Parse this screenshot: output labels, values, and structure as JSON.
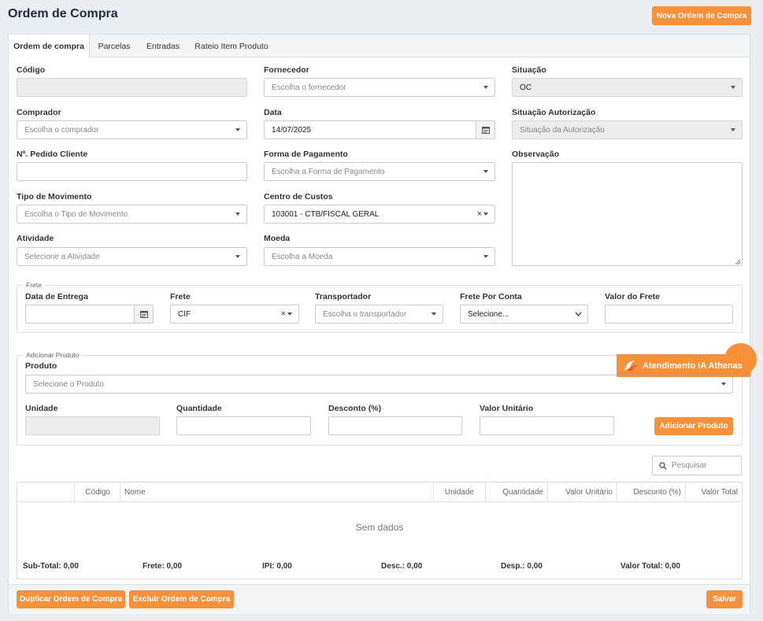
{
  "header": {
    "title": "Ordem de Compra",
    "new_button": "Nova Ordem de Compra"
  },
  "tabs": [
    {
      "label": "Ordem de compra",
      "active": true
    },
    {
      "label": "Parcelas"
    },
    {
      "label": "Entradas"
    },
    {
      "label": "Rateio Item Produto"
    }
  ],
  "form": {
    "codigo": {
      "label": "Código",
      "value": ""
    },
    "fornecedor": {
      "label": "Fornecedor",
      "placeholder": "Escolha o fornecedor"
    },
    "situacao": {
      "label": "Situação",
      "value": "OC"
    },
    "comprador": {
      "label": "Comprador",
      "placeholder": "Escolha o comprador"
    },
    "data": {
      "label": "Data",
      "value": "14/07/2025"
    },
    "situacao_autorizacao": {
      "label": "Situação Autorização",
      "placeholder": "Situação da Autorização"
    },
    "pedido_cliente": {
      "label": "Nº. Pedido Cliente",
      "value": ""
    },
    "forma_pagamento": {
      "label": "Forma de Pagamento",
      "placeholder": "Escolha a Forma de Pagamento"
    },
    "observacao": {
      "label": "Observação",
      "value": ""
    },
    "tipo_movimento": {
      "label": "Tipo de Movimento",
      "placeholder": "Escolha o Tipo de Movimento"
    },
    "centro_custos": {
      "label": "Centro de Custos",
      "value": "103001 - CTB/FISCAL GERAL"
    },
    "atividade": {
      "label": "Atividade",
      "placeholder": "Selecione a Atividade"
    },
    "moeda": {
      "label": "Moeda",
      "placeholder": "Escolha a Moeda"
    }
  },
  "frete": {
    "legend": "Frete",
    "data_entrega": {
      "label": "Data de Entrega",
      "value": ""
    },
    "frete": {
      "label": "Frete",
      "value": "CIF"
    },
    "transportador": {
      "label": "Transportador",
      "placeholder": "Escolha o transportador"
    },
    "frete_por_conta": {
      "label": "Frete Por Conta",
      "value": "Selecione..."
    },
    "valor_frete": {
      "label": "Valor do Frete",
      "value": ""
    }
  },
  "produto": {
    "legend": "Adicionar Produto",
    "produto": {
      "label": "Produto",
      "placeholder": "Selecione o Produto"
    },
    "unidade": {
      "label": "Unidade"
    },
    "quantidade": {
      "label": "Quantidade"
    },
    "desconto": {
      "label": "Desconto (%)"
    },
    "valor_unitario": {
      "label": "Valor Unitário"
    },
    "add_button": "Adicionar Produto"
  },
  "chat_widget": {
    "label": "Atendimento IA Athenas"
  },
  "search": {
    "placeholder": "Pesquisar"
  },
  "table": {
    "columns": [
      "",
      "Código",
      "Nome",
      "Unidade",
      "Quantidade",
      "Valor Unitário",
      "Desconto (%)",
      "Valor Total"
    ],
    "empty": "Sem dados",
    "totals": [
      "Sub-Total: 0,00",
      "Frete: 0,00",
      "IPI: 0,00",
      "Desc.: 0,00",
      "Desp.: 0,00",
      "Valor Total: 0,00"
    ]
  },
  "footer": {
    "duplicate": "Duplicar Ordem de Compra",
    "delete": "Excluir Ordem de Compra",
    "save": "Salvar"
  },
  "colors": {
    "accent": "#f7913b",
    "background": "#eaedf1"
  },
  "icons": {
    "calendar": "calendar-icon",
    "search": "search-icon",
    "caret": "chevron-down-icon"
  }
}
